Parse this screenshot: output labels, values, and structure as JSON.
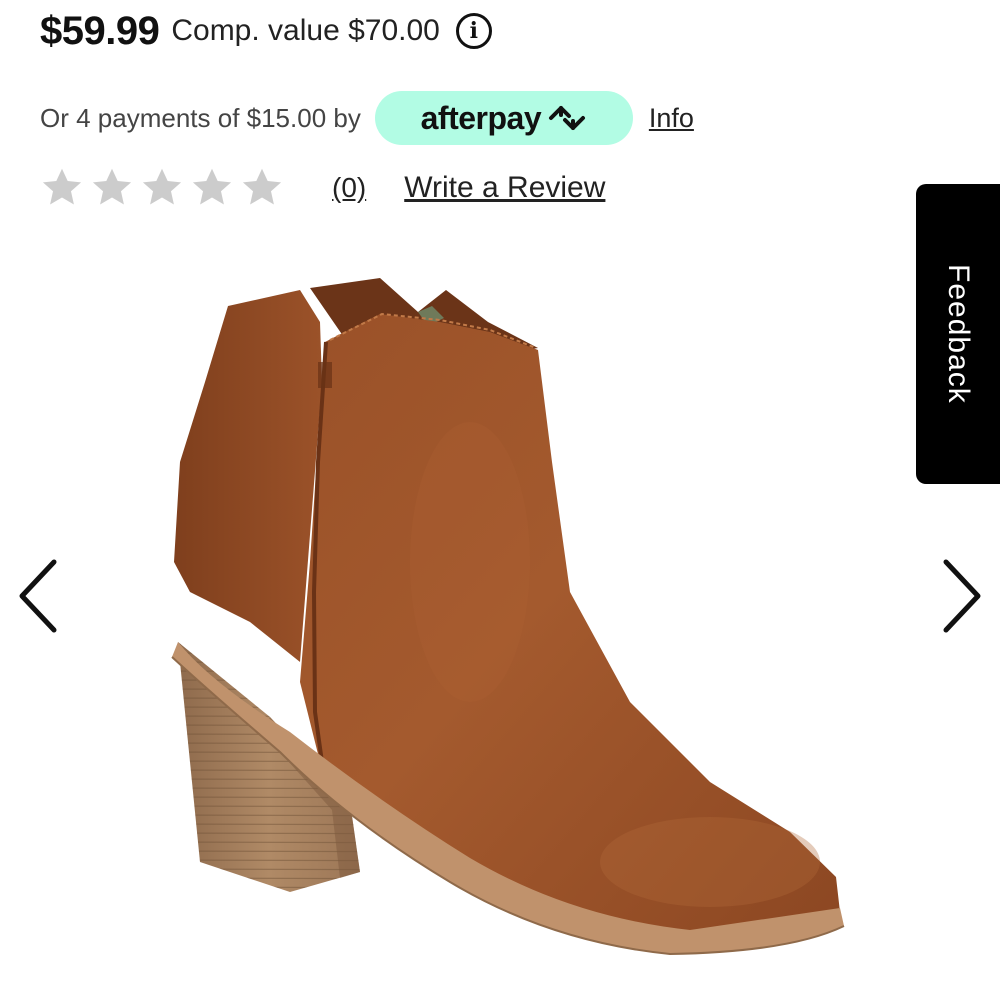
{
  "price": {
    "current": "$59.99",
    "comp_value": "Comp. value $70.00",
    "info_icon": "info-circle-icon"
  },
  "afterpay": {
    "payments_text": "Or 4 payments of $15.00 by",
    "brand": "afterpay",
    "brand_color": "#b2fce4",
    "info_link": "Info"
  },
  "rating": {
    "stars_filled": 0,
    "stars_total": 5,
    "star_color": "#cccccc",
    "count": "(0)",
    "write_review": "Write a Review"
  },
  "feedback": {
    "label": "Feedback"
  },
  "carousel": {
    "prev_icon": "chevron-left-icon",
    "next_icon": "chevron-right-icon"
  },
  "product": {
    "image": "brown-suede-ankle-boot"
  }
}
